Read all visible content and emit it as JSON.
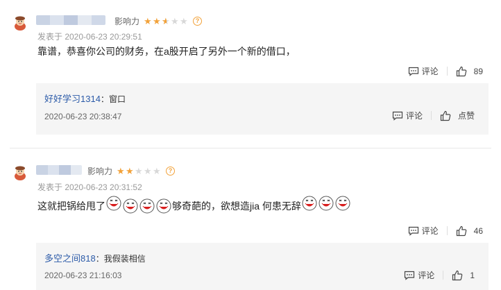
{
  "comments": [
    {
      "influence_label": "影响力",
      "stars": [
        1,
        1,
        0.5,
        0,
        0
      ],
      "help": "?",
      "date": "发表于 2020-06-23 20:29:51",
      "text": "靠谱，恭喜你公司的财务，在a股开启了另外一个新的借口，",
      "comment_label": "评论",
      "like_count": "89",
      "reply": {
        "user": "好好学习1314",
        "colon": "：",
        "text": "窗口",
        "date": "2020-06-23 20:38:47",
        "comment_label": "评论",
        "like_label": "点赞"
      }
    },
    {
      "influence_label": "影响力",
      "stars": [
        1,
        1,
        0,
        0,
        0
      ],
      "help": "?",
      "date": "发表于 2020-06-23 20:31:52",
      "text_a": "这就把锅给甩了",
      "text_b": "够奇葩的，欲想造jia 何患无辞",
      "comment_label": "评论",
      "like_count": "46",
      "reply": {
        "user": "多空之间818",
        "colon": "：",
        "text": "我假装相信",
        "date": "2020-06-23 21:16:03",
        "comment_label": "评论",
        "like_count": "1"
      }
    }
  ],
  "emoji_name": "laugh-emoji",
  "colors": {
    "star": "#f2a23a",
    "reply_user": "#2b5aa8",
    "reply_bg": "#f5f5f5"
  }
}
